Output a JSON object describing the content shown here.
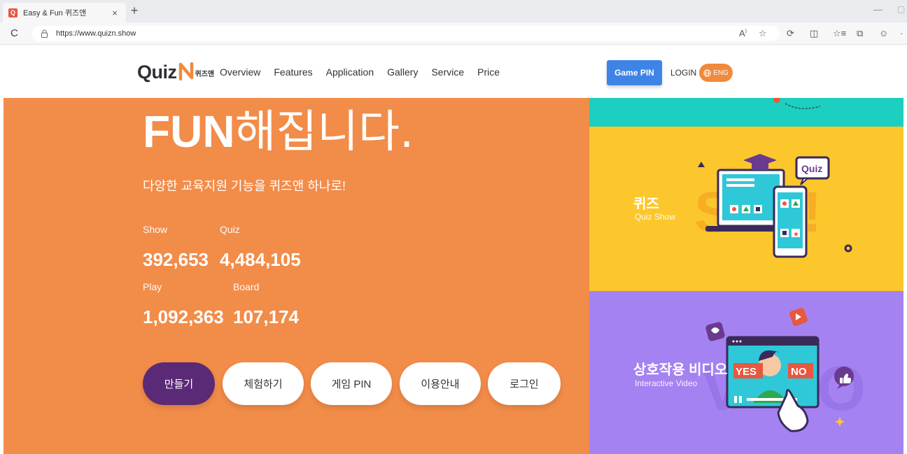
{
  "browser": {
    "tab_title": "Easy & Fun 퀴즈앤",
    "favicon_letter": "Q",
    "tab_close": "×",
    "new_tab": "+",
    "url": "https://www.quizn.show",
    "reload_icon": "C"
  },
  "header": {
    "logo_text": "Quiz",
    "logo_kr": "퀴즈앤",
    "nav": [
      "Overview",
      "Features",
      "Application",
      "Gallery",
      "Service",
      "Price"
    ],
    "game_pin_label": "Game PIN",
    "login_label": "LOGIN",
    "lang_label": "ENG"
  },
  "hero": {
    "title_strong": "FUN",
    "title_light": "해집니다.",
    "subtitle": "다양한 교육지원 기능을 퀴즈앤 하나로!",
    "stats": [
      {
        "label": "Show",
        "value": "392,653"
      },
      {
        "label": "Quiz",
        "value": "4,484,105"
      },
      {
        "label": "Play",
        "value": "1,092,363"
      },
      {
        "label": "Board",
        "value": "107,174"
      }
    ],
    "buttons": [
      "만들기",
      "체험하기",
      "게임 PIN",
      "이용안내",
      "로그인"
    ]
  },
  "cards": {
    "quiz": {
      "title": "퀴즈",
      "subtitle": "Quiz Show",
      "badge": "Quiz",
      "bg_text": "S    W!"
    },
    "video": {
      "title": "상호작용 비디오",
      "subtitle": "Interactive Video",
      "yes": "YES",
      "no": "NO"
    }
  },
  "colors": {
    "orange": "#f28c49",
    "purple_btn": "#5b2a76",
    "teal": "#1ccfc0",
    "yellow": "#fcc72c",
    "lavender": "#a582f1",
    "blue": "#3e84e7"
  }
}
